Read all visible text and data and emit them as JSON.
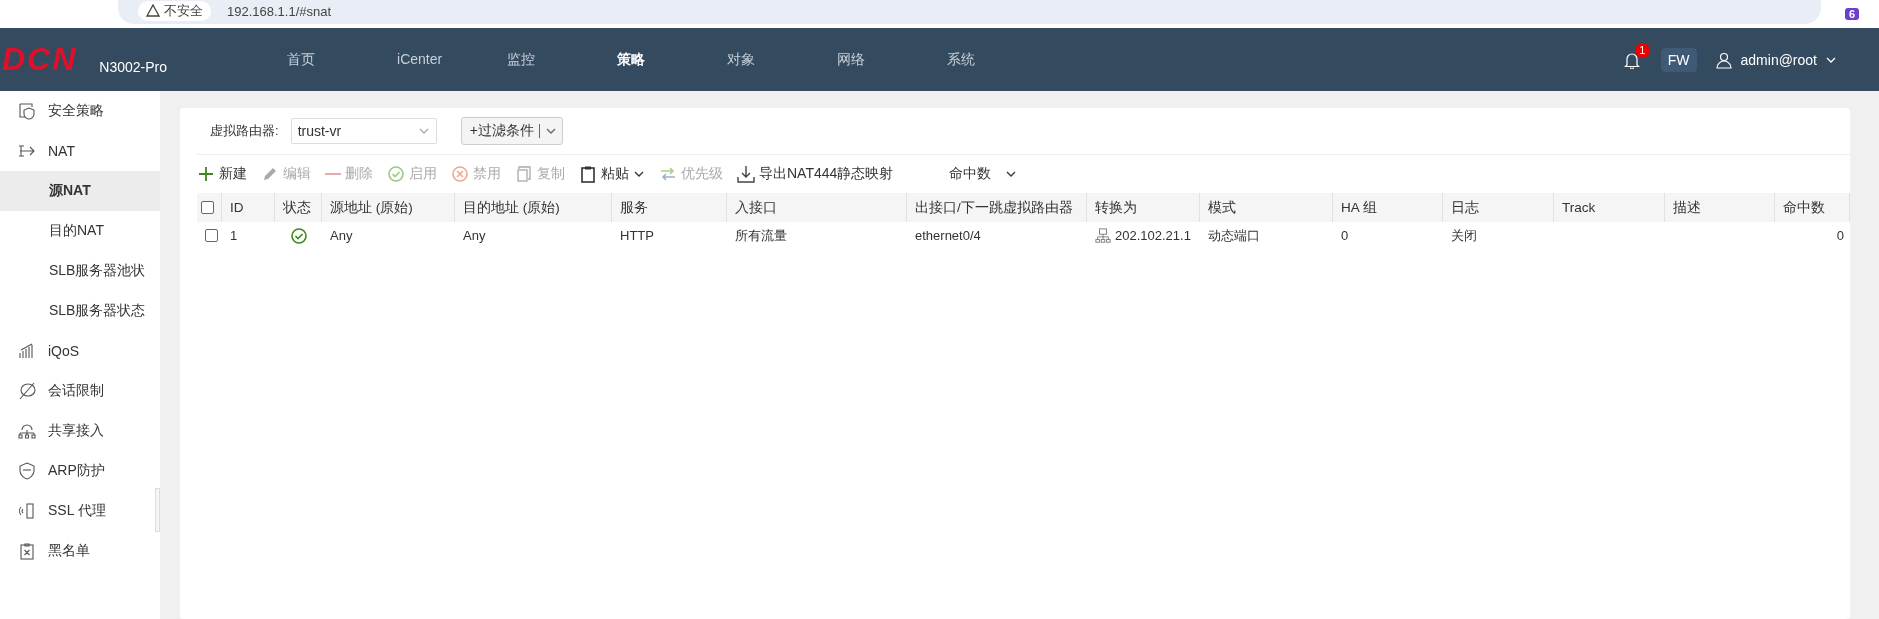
{
  "browser": {
    "security": "不安全",
    "url": "192.168.1.1/#snat",
    "extension_badge": "6"
  },
  "header": {
    "logo": "DCN",
    "model": "N3002-Pro",
    "nav": [
      {
        "label": "首页",
        "selected": false
      },
      {
        "label": "iCenter",
        "selected": false
      },
      {
        "label": "监控",
        "selected": false
      },
      {
        "label": "策略",
        "selected": true
      },
      {
        "label": "对象",
        "selected": false
      },
      {
        "label": "网络",
        "selected": false
      },
      {
        "label": "系统",
        "selected": false
      }
    ],
    "notifications": "1",
    "mode": "FW",
    "user": "admin@root"
  },
  "sidebar": {
    "items": [
      {
        "label": "安全策略",
        "kind": "shield"
      },
      {
        "label": "NAT",
        "kind": "nat",
        "children": [
          {
            "label": "源NAT",
            "selected": true
          },
          {
            "label": "目的NAT",
            "selected": false
          },
          {
            "label": "SLB服务器池状",
            "selected": false
          },
          {
            "label": "SLB服务器状态",
            "selected": false
          }
        ]
      },
      {
        "label": "iQoS",
        "kind": "bars"
      },
      {
        "label": "会话限制",
        "kind": "limit"
      },
      {
        "label": "共享接入",
        "kind": "cloud"
      },
      {
        "label": "ARP防护",
        "kind": "arp"
      },
      {
        "label": "SSL 代理",
        "kind": "ssl"
      },
      {
        "label": "黑名单",
        "kind": "blacklist"
      }
    ]
  },
  "filter": {
    "label": "虚拟路由器:",
    "router": "trust-vr",
    "filter_button": "+过滤条件"
  },
  "toolbar": [
    {
      "label": "新建",
      "kind": "add",
      "disabled": false
    },
    {
      "label": "编辑",
      "kind": "edit",
      "disabled": true
    },
    {
      "label": "删除",
      "kind": "delete",
      "disabled": true
    },
    {
      "label": "启用",
      "kind": "enable",
      "disabled": true
    },
    {
      "label": "禁用",
      "kind": "disable",
      "disabled": true
    },
    {
      "label": "复制",
      "kind": "copy",
      "disabled": true
    },
    {
      "label": "粘贴",
      "kind": "paste",
      "disabled": false
    },
    {
      "label": "优先级",
      "kind": "priority",
      "disabled": true
    },
    {
      "label": "导出NAT444静态映射",
      "kind": "export",
      "disabled": false
    }
  ],
  "hit_count_menu": "命中数",
  "table": {
    "select_all_checked": false,
    "columns": [
      "ID",
      "状态",
      "源地址 (原始)",
      "目的地址 (原始)",
      "服务",
      "入接口",
      "出接口/下一跳虚拟路由器",
      "转换为",
      "模式",
      "HA 组",
      "日志",
      "Track",
      "描述",
      "命中数"
    ],
    "rows": [
      {
        "selected": false,
        "id": "1",
        "enabled": true,
        "source": "Any",
        "destination": "Any",
        "service": "HTTP",
        "ingress": "所有流量",
        "egress": "ethernet0/4",
        "translate_to": "202.102.21.1",
        "mode": "动态端口",
        "ha_group": "0",
        "log": "关闭",
        "hit_count": "0"
      }
    ]
  }
}
